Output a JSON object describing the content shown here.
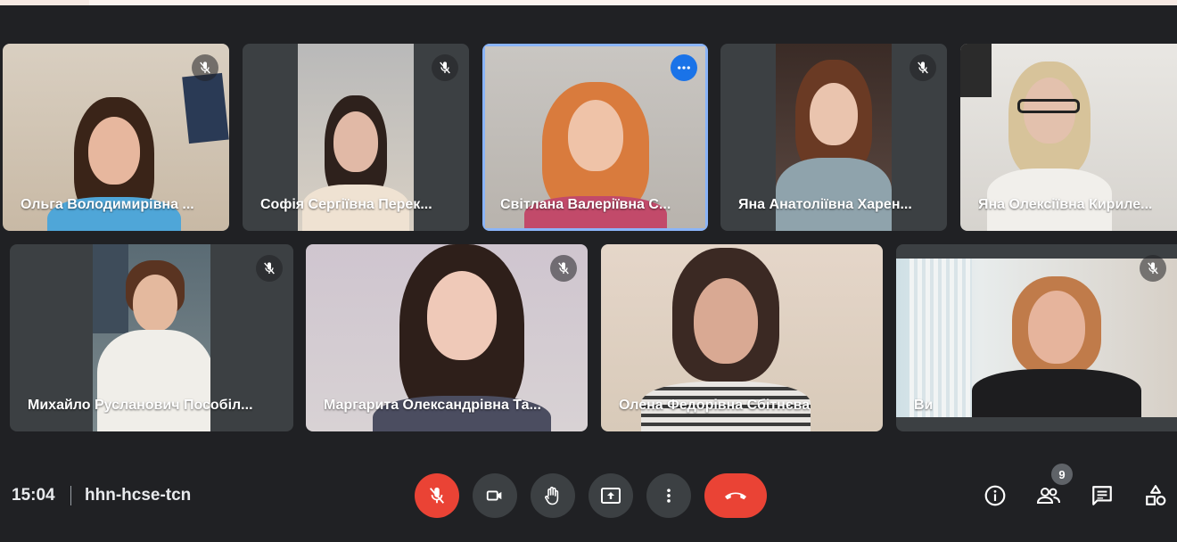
{
  "participants": [
    {
      "name": "Ольга Володимирівна ...",
      "muted": true
    },
    {
      "name": "Софія Сергіївна Перек...",
      "muted": true
    },
    {
      "name": "Світлана Валеріївна С...",
      "muted": false,
      "active": true
    },
    {
      "name": "Яна Анатоліївна Харен...",
      "muted": true
    },
    {
      "name": "Яна Олексіївна Кириле...",
      "muted": false
    },
    {
      "name": "Михайло Русланович Пособіл...",
      "muted": true
    },
    {
      "name": "Маргарита Олександрівна Та...",
      "muted": true
    },
    {
      "name": "Олена Федорівна Сбітнєва",
      "muted": false
    },
    {
      "name": "Ви",
      "muted": true
    }
  ],
  "meeting": {
    "time": "15:04",
    "code": "hhn-hcse-tcn",
    "participant_count": "9"
  },
  "controls": {
    "mic": {
      "icon": "mic-off-icon",
      "state": "off"
    },
    "camera": {
      "icon": "videocam-icon"
    },
    "raise_hand": {
      "icon": "hand-icon"
    },
    "present": {
      "icon": "present-screen-icon"
    },
    "more": {
      "icon": "more-vert-icon"
    },
    "hangup": {
      "icon": "call-end-icon"
    }
  },
  "side_controls": [
    "info-icon",
    "people-icon",
    "chat-icon",
    "activities-icon"
  ],
  "colors": {
    "background": "#202124",
    "tile": "#3c4043",
    "accent": "#1a73e8",
    "danger": "#ea4335",
    "active_outline": "#8ab4f8"
  }
}
